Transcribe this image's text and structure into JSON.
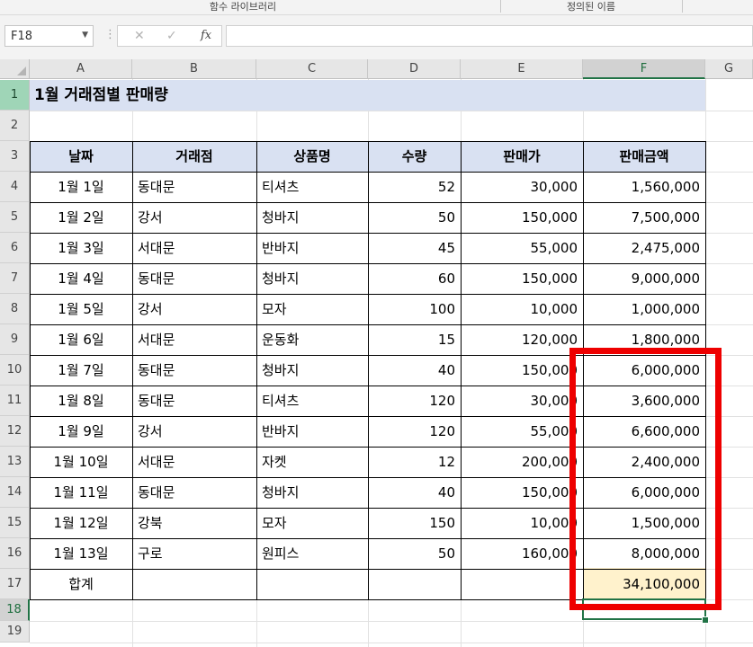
{
  "ribbon": {
    "group1": "함수 라이브러리",
    "group2": "정의된 이름"
  },
  "formula_bar": {
    "name_box": "F18",
    "cancel_icon": "✕",
    "enter_icon": "✓",
    "fx_label": "fx",
    "formula": ""
  },
  "columns": [
    "A",
    "B",
    "C",
    "D",
    "E",
    "F",
    "G"
  ],
  "rows": [
    "1",
    "2",
    "3",
    "4",
    "5",
    "6",
    "7",
    "8",
    "9",
    "10",
    "11",
    "12",
    "13",
    "14",
    "15",
    "16",
    "17",
    "18",
    "19"
  ],
  "sheet": {
    "title": "1월 거래점별 판매량",
    "headers": [
      "날짜",
      "거래점",
      "상품명",
      "수량",
      "판매가",
      "판매금액"
    ],
    "data": [
      [
        "1월 1일",
        "동대문",
        "티셔츠",
        "52",
        "30,000",
        "1,560,000"
      ],
      [
        "1월 2일",
        "강서",
        "청바지",
        "50",
        "150,000",
        "7,500,000"
      ],
      [
        "1월 3일",
        "서대문",
        "반바지",
        "45",
        "55,000",
        "2,475,000"
      ],
      [
        "1월 4일",
        "동대문",
        "청바지",
        "60",
        "150,000",
        "9,000,000"
      ],
      [
        "1월 5일",
        "강서",
        "모자",
        "100",
        "10,000",
        "1,000,000"
      ],
      [
        "1월 6일",
        "서대문",
        "운동화",
        "15",
        "120,000",
        "1,800,000"
      ],
      [
        "1월 7일",
        "동대문",
        "청바지",
        "40",
        "150,000",
        "6,000,000"
      ],
      [
        "1월 8일",
        "동대문",
        "티셔츠",
        "120",
        "30,000",
        "3,600,000"
      ],
      [
        "1월 9일",
        "강서",
        "반바지",
        "120",
        "55,000",
        "6,600,000"
      ],
      [
        "1월 10일",
        "서대문",
        "자켓",
        "12",
        "200,000",
        "2,400,000"
      ],
      [
        "1월 11일",
        "동대문",
        "청바지",
        "40",
        "150,000",
        "6,000,000"
      ],
      [
        "1월 12일",
        "강북",
        "모자",
        "150",
        "10,000",
        "1,500,000"
      ],
      [
        "1월 13일",
        "구로",
        "원피스",
        "50",
        "160,000",
        "8,000,000"
      ]
    ],
    "total_label": "합계",
    "total_value": "34,100,000"
  },
  "colors": {
    "header_fill": "#d9e1f2",
    "total_fill": "#fff2cc",
    "selection": "#217346",
    "annotation": "#ee0000"
  }
}
